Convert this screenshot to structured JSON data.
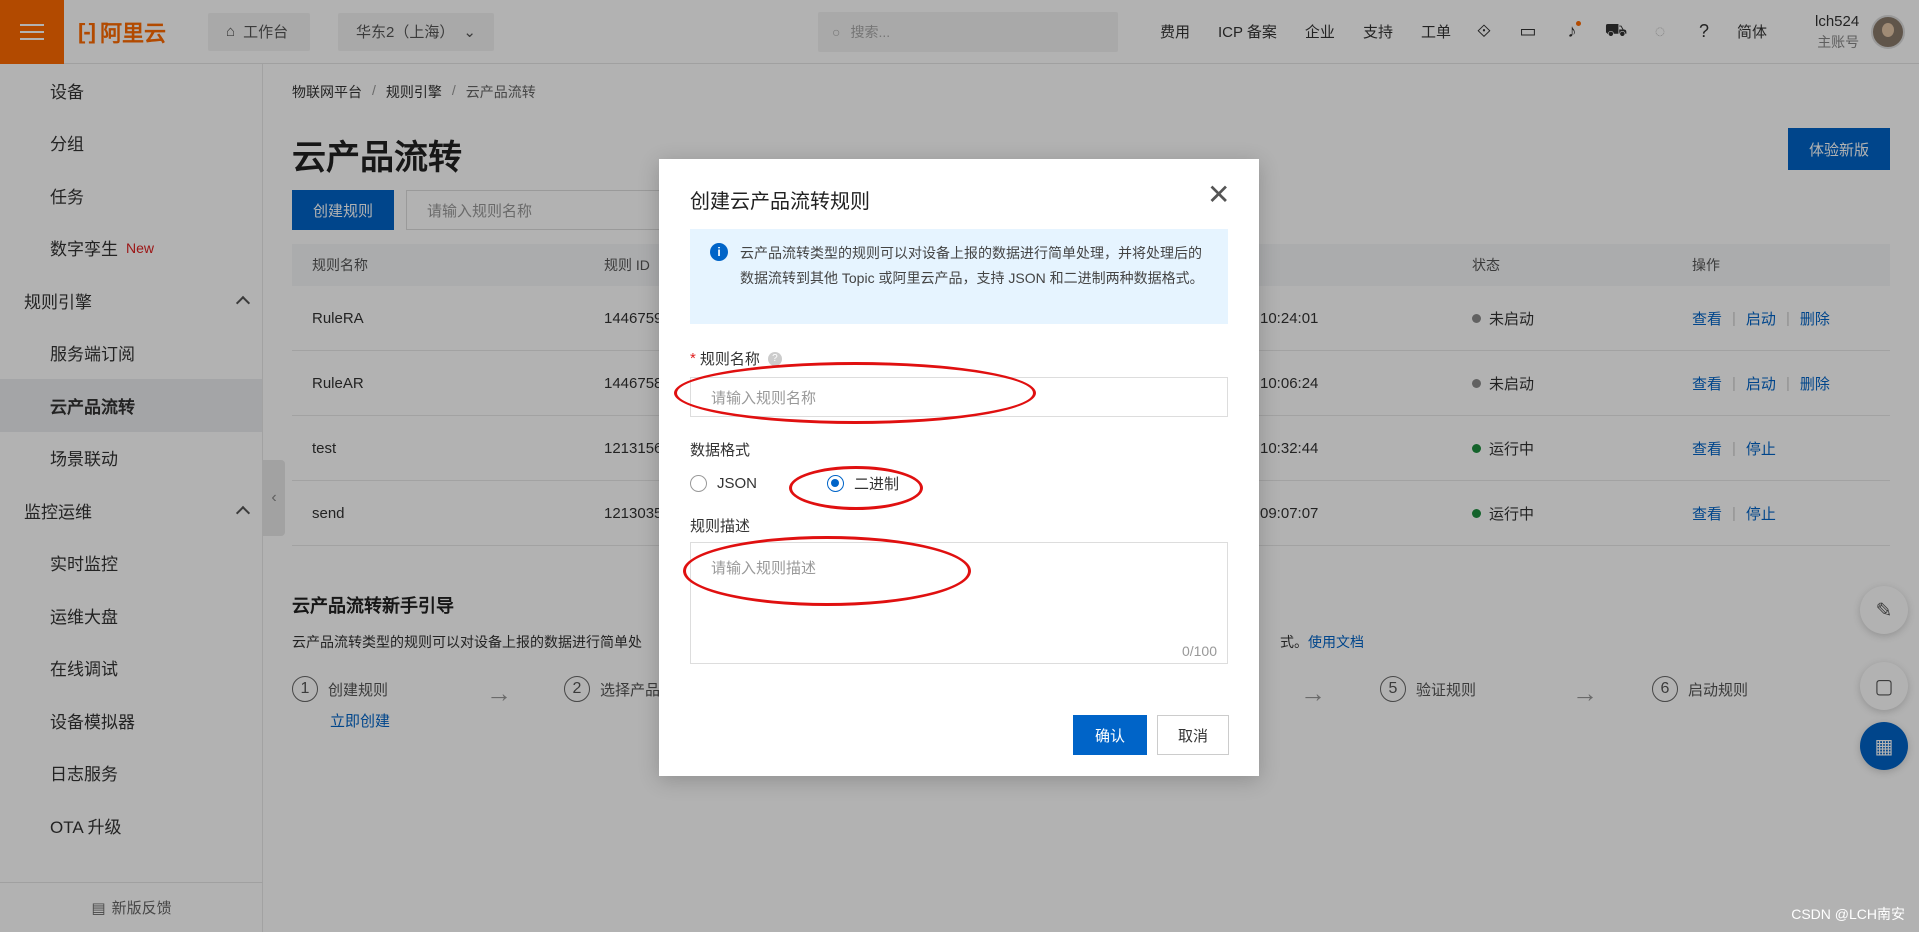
{
  "topbar": {
    "logo_text": "阿里云",
    "workbench_label": "工作台",
    "region_label": "华东2（上海）",
    "search_placeholder": "搜索...",
    "links": [
      "费用",
      "ICP 备案",
      "企业",
      "支持",
      "工单"
    ],
    "lang_label": "简体",
    "user_name": "lch524",
    "user_role": "主账号"
  },
  "sidebar": {
    "items": [
      {
        "label": "设备",
        "type": "item"
      },
      {
        "label": "分组",
        "type": "item"
      },
      {
        "label": "任务",
        "type": "item"
      },
      {
        "label": "数字孪生",
        "type": "item",
        "tag": "New"
      },
      {
        "label": "规则引擎",
        "type": "group"
      },
      {
        "label": "服务端订阅",
        "type": "item"
      },
      {
        "label": "云产品流转",
        "type": "item",
        "active": true
      },
      {
        "label": "场景联动",
        "type": "item"
      },
      {
        "label": "监控运维",
        "type": "group"
      },
      {
        "label": "实时监控",
        "type": "item"
      },
      {
        "label": "运维大盘",
        "type": "item"
      },
      {
        "label": "在线调试",
        "type": "item"
      },
      {
        "label": "设备模拟器",
        "type": "item"
      },
      {
        "label": "日志服务",
        "type": "item"
      },
      {
        "label": "OTA 升级",
        "type": "item"
      }
    ],
    "footer_label": "新版反馈"
  },
  "main": {
    "breadcrumb": [
      "物联网平台",
      "规则引擎",
      "云产品流转"
    ],
    "title": "云产品流转",
    "try_new_label": "体验新版",
    "create_label": "创建规则",
    "search_placeholder": "请输入规则名称",
    "table": {
      "headers": {
        "name": "规则名称",
        "id": "规则 ID",
        "status": "状态",
        "ops": "操作"
      },
      "rows": [
        {
          "name": "RuleRA",
          "id": "1446759",
          "time": "10:24:01",
          "status": "未启动",
          "status_color": "#8c8c8c",
          "ops": [
            "查看",
            "启动",
            "删除"
          ]
        },
        {
          "name": "RuleAR",
          "id": "1446758",
          "time": "10:06:24",
          "status": "未启动",
          "status_color": "#8c8c8c",
          "ops": [
            "查看",
            "启动",
            "删除"
          ]
        },
        {
          "name": "test",
          "id": "1213156",
          "time": "10:32:44",
          "status": "运行中",
          "status_color": "#1e8e3e",
          "ops": [
            "查看",
            "停止"
          ]
        },
        {
          "name": "send",
          "id": "1213035",
          "time": "09:07:07",
          "status": "运行中",
          "status_color": "#1e8e3e",
          "ops": [
            "查看",
            "停止"
          ]
        }
      ]
    },
    "guide": {
      "title": "云产品流转新手引导",
      "desc": "云产品流转类型的规则可以对设备上报的数据进行简单处",
      "doc_prefix": "式。",
      "doc_link": "使用文档",
      "steps": [
        {
          "num": "1",
          "label": "创建规则"
        },
        {
          "num": "2",
          "label": "选择产品"
        },
        {
          "num": "5",
          "label": "验证规则"
        },
        {
          "num": "6",
          "label": "启动规则"
        }
      ],
      "create_now": "立即创建"
    }
  },
  "dialog": {
    "title": "创建云产品流转规则",
    "info_text": "云产品流转类型的规则可以对设备上报的数据进行简单处理，并将处理后的数据流转到其他 Topic 或阿里云产品，支持 JSON 和二进制两种数据格式。",
    "name_label": "规则名称",
    "name_placeholder": "请输入规则名称",
    "format_label": "数据格式",
    "format_options": [
      "JSON",
      "二进制"
    ],
    "format_selected": "二进制",
    "desc_label": "规则描述",
    "desc_placeholder": "请输入规则描述",
    "desc_counter": "0/100",
    "ok_label": "确认",
    "cancel_label": "取消"
  },
  "watermark": "CSDN @LCH南安",
  "colors": {
    "brand": "#ff6a00",
    "primary": "#0064c8",
    "annotation": "#e01010"
  }
}
